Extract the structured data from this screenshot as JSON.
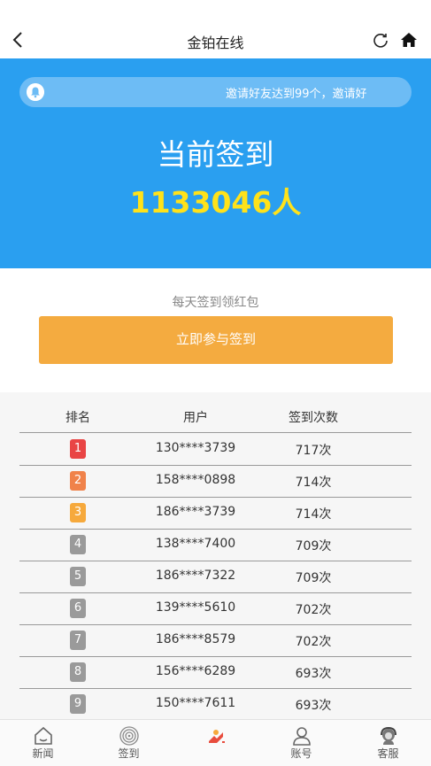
{
  "header": {
    "title": "金铂在线"
  },
  "banner": {
    "notice": "邀请好友达到99个，邀请好",
    "label": "当前签到",
    "count": "1133046人"
  },
  "signin": {
    "tip": "每天签到领红包",
    "button_label": "立即参与签到"
  },
  "ranking": {
    "columns": [
      "排名",
      "用户",
      "签到次数"
    ],
    "rows": [
      {
        "rank": "1",
        "user": "130****3739",
        "times": "717次",
        "color": "#e94545"
      },
      {
        "rank": "2",
        "user": "158****0898",
        "times": "714次",
        "color": "#f0824a"
      },
      {
        "rank": "3",
        "user": "186****3739",
        "times": "714次",
        "color": "#f6a93c"
      },
      {
        "rank": "4",
        "user": "138****7400",
        "times": "709次",
        "color": "#9a9a9a"
      },
      {
        "rank": "5",
        "user": "186****7322",
        "times": "709次",
        "color": "#9a9a9a"
      },
      {
        "rank": "6",
        "user": "139****5610",
        "times": "702次",
        "color": "#9a9a9a"
      },
      {
        "rank": "7",
        "user": "186****8579",
        "times": "702次",
        "color": "#9a9a9a"
      },
      {
        "rank": "8",
        "user": "156****6289",
        "times": "693次",
        "color": "#9a9a9a"
      },
      {
        "rank": "9",
        "user": "150****7611",
        "times": "693次",
        "color": "#9a9a9a"
      }
    ]
  },
  "tabbar": {
    "items": [
      {
        "label": "新闻",
        "icon": "news-icon"
      },
      {
        "label": "签到",
        "icon": "fingerprint-icon"
      },
      {
        "label": "",
        "icon": "signin-hand-icon"
      },
      {
        "label": "账号",
        "icon": "user-icon"
      },
      {
        "label": "客服",
        "icon": "customer-service-icon"
      }
    ]
  },
  "colors": {
    "banner_blue": "#2a9ff0",
    "count_yellow": "#ffe21a",
    "button_orange": "#f4ab40"
  }
}
